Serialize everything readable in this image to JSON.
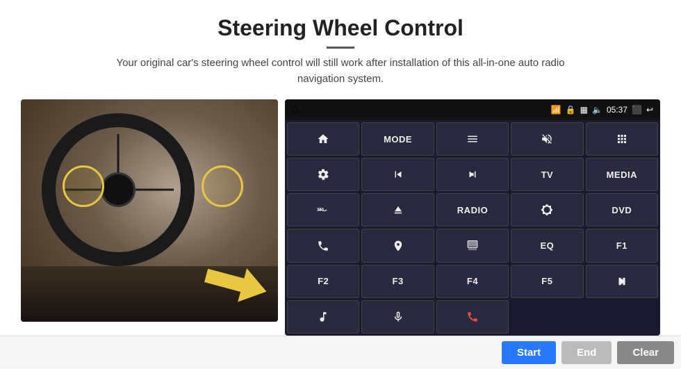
{
  "page": {
    "title": "Steering Wheel Control",
    "subtitle": "Your original car's steering wheel control will still work after installation of this all-in-one auto radio navigation system."
  },
  "status_bar": {
    "time": "05:37",
    "icons": [
      "wifi",
      "lock",
      "sim",
      "bluetooth",
      "cast",
      "back"
    ]
  },
  "radio_buttons": [
    {
      "id": "home",
      "type": "icon",
      "icon": "home"
    },
    {
      "id": "mode",
      "type": "text",
      "label": "MODE"
    },
    {
      "id": "menu",
      "type": "icon",
      "icon": "menu"
    },
    {
      "id": "mute",
      "type": "icon",
      "icon": "mute"
    },
    {
      "id": "apps",
      "type": "icon",
      "icon": "apps"
    },
    {
      "id": "settings",
      "type": "icon",
      "icon": "settings"
    },
    {
      "id": "prev",
      "type": "icon",
      "icon": "prev"
    },
    {
      "id": "next",
      "type": "icon",
      "icon": "next"
    },
    {
      "id": "tv",
      "type": "text",
      "label": "TV"
    },
    {
      "id": "media",
      "type": "text",
      "label": "MEDIA"
    },
    {
      "id": "camera360",
      "type": "icon",
      "icon": "360cam"
    },
    {
      "id": "eject",
      "type": "icon",
      "icon": "eject"
    },
    {
      "id": "radio",
      "type": "text",
      "label": "RADIO"
    },
    {
      "id": "brightness",
      "type": "icon",
      "icon": "brightness"
    },
    {
      "id": "dvd",
      "type": "text",
      "label": "DVD"
    },
    {
      "id": "phone",
      "type": "icon",
      "icon": "phone"
    },
    {
      "id": "navigation",
      "type": "icon",
      "icon": "navigation"
    },
    {
      "id": "screen",
      "type": "icon",
      "icon": "screen"
    },
    {
      "id": "eq",
      "type": "text",
      "label": "EQ"
    },
    {
      "id": "f1",
      "type": "text",
      "label": "F1"
    },
    {
      "id": "f2",
      "type": "text",
      "label": "F2"
    },
    {
      "id": "f3",
      "type": "text",
      "label": "F3"
    },
    {
      "id": "f4",
      "type": "text",
      "label": "F4"
    },
    {
      "id": "f5",
      "type": "text",
      "label": "F5"
    },
    {
      "id": "playpause",
      "type": "icon",
      "icon": "playpause"
    },
    {
      "id": "music",
      "type": "icon",
      "icon": "music"
    },
    {
      "id": "mic",
      "type": "icon",
      "icon": "mic"
    },
    {
      "id": "hangup",
      "type": "icon",
      "icon": "hangup"
    },
    {
      "id": "empty1",
      "type": "empty",
      "label": ""
    },
    {
      "id": "empty2",
      "type": "empty",
      "label": ""
    }
  ],
  "bottom_buttons": {
    "start": "Start",
    "end": "End",
    "clear": "Clear"
  }
}
